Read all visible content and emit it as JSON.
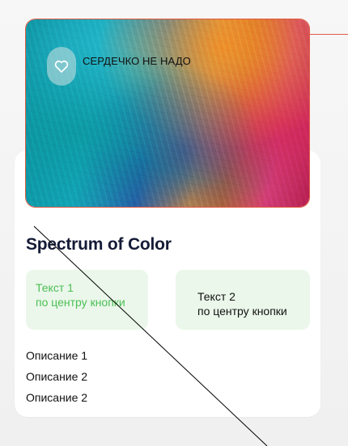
{
  "hero": {
    "favorite_label": "СЕРДЕЧКО НЕ НАДО",
    "favorite_icon": "heart-icon"
  },
  "card": {
    "title": "Spectrum of Color",
    "button1": {
      "line1": "Текст 1",
      "line2": "по центру кнопки"
    },
    "button2": {
      "line1": "Текст 2",
      "line2": "по центру кнопки"
    },
    "descriptions": [
      "Описание 1",
      "Описание 2",
      "Описание 2"
    ]
  },
  "colors": {
    "accent_outline": "#e15b44",
    "button_bg": "#eaf7ea",
    "button1_text": "#4cbf55",
    "title_text": "#151b36"
  }
}
